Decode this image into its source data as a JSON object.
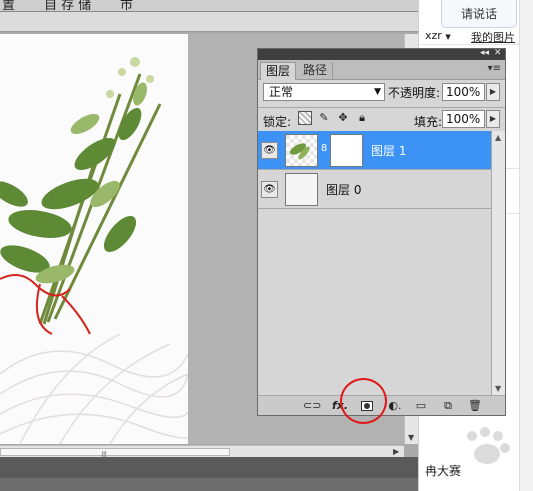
{
  "topbar": {
    "fragments": [
      "置",
      "自 存 储",
      "市"
    ]
  },
  "right_pane": {
    "say_button": "请说话",
    "user": "xzr",
    "user_arrow": "▼",
    "my_pictures": "我的图片",
    "footer_text": "冉大赛"
  },
  "layers_panel": {
    "window_controls": {
      "collapse": "◂◂",
      "close": "✕"
    },
    "tabs": [
      {
        "label": "图层",
        "active": true
      },
      {
        "label": "路径",
        "active": false
      }
    ],
    "menu_icon": "▾≡",
    "blend_mode": "正常",
    "opacity_label": "不透明度:",
    "opacity_value": "100%",
    "lock_label": "锁定:",
    "lock_icons": [
      "lock-transparent-icon",
      "lock-image-icon",
      "lock-position-icon",
      "lock-all-icon"
    ],
    "fill_label": "填充:",
    "fill_value": "100%",
    "layers": [
      {
        "name": "图层 1",
        "selected": true,
        "has_mask": true,
        "visible": true
      },
      {
        "name": "图层 0",
        "selected": false,
        "has_mask": false,
        "visible": true
      }
    ],
    "footer_icons": [
      "link-layers-icon",
      "fx-icon",
      "add-mask-icon",
      "adjustment-layer-icon",
      "new-group-icon",
      "new-layer-icon",
      "delete-layer-icon"
    ],
    "highlight_color": "#3c92f5",
    "annotation_color": "#e01818"
  }
}
